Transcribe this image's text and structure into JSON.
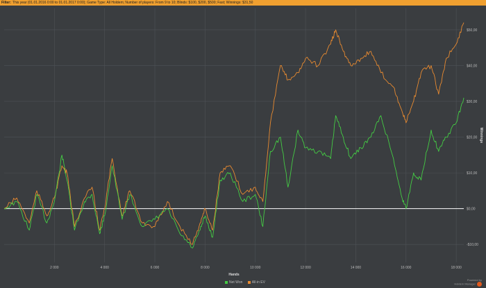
{
  "filter": {
    "label": "Filter:",
    "text": "This year (01.01.2016 0:00 to 01.01.2017 0:00); Game Type: All Holdem; Number of players: From 9 to 10; Blinds: $100, $200, $500; Fast; Winnings: $31,50"
  },
  "colors": {
    "net_won": "#44cc44",
    "all_in_ev": "#e88a30",
    "background": "#3a3d40",
    "grid": "#4e5256",
    "zero_line": "#ffffff"
  },
  "branding": {
    "line1": "Powered by",
    "line2": "Holdem Manager"
  },
  "chart_data": {
    "type": "line",
    "xlabel": "Hands",
    "ylabel": "Winnings",
    "xlim": [
      0,
      18300
    ],
    "ylim": [
      -15,
      56
    ],
    "x_ticks": [
      2000,
      4000,
      6000,
      8000,
      10000,
      12000,
      14000,
      16000,
      18000
    ],
    "x_tick_labels": [
      "2 000",
      "4 000",
      "6 000",
      "8 000",
      "10 000",
      "12 000",
      "14 000",
      "16 000",
      "18 000"
    ],
    "y_ticks": [
      -10,
      0,
      10,
      20,
      30,
      40,
      50
    ],
    "y_tick_labels": [
      "-$10,00",
      "$0,00",
      "$10,00",
      "$20,00",
      "$30,00",
      "$40,00",
      "$50,00"
    ],
    "grid": true,
    "legend": "bottom-center",
    "x": [
      0,
      500,
      1000,
      1300,
      1700,
      2000,
      2300,
      2500,
      2800,
      3200,
      3500,
      3800,
      4000,
      4300,
      4700,
      5000,
      5500,
      6000,
      6500,
      7000,
      7500,
      7800,
      8000,
      8300,
      8600,
      9000,
      9500,
      10000,
      10300,
      10600,
      11000,
      11300,
      11700,
      12000,
      12500,
      13000,
      13200,
      13500,
      13800,
      14200,
      14600,
      15000,
      15500,
      15800,
      16000,
      16300,
      16600,
      17000,
      17300,
      17600,
      18000,
      18300
    ],
    "series": [
      {
        "name": "Net Won",
        "values": [
          0,
          2,
          -6,
          4,
          -4,
          2,
          15,
          8,
          -6,
          2,
          4,
          -7,
          -2,
          12,
          -3,
          4,
          -5,
          -3,
          0,
          -7,
          -11,
          -6,
          -2,
          -8,
          8,
          10,
          2,
          4,
          -5,
          16,
          20,
          6,
          22,
          17,
          16,
          14,
          26,
          20,
          14,
          17,
          20,
          26,
          14,
          4,
          0,
          10,
          8,
          22,
          16,
          20,
          24,
          31
        ]
      },
      {
        "name": "All-in EV",
        "values": [
          0,
          3,
          -4,
          5,
          -2,
          3,
          12,
          10,
          -5,
          3,
          6,
          -6,
          0,
          14,
          -2,
          5,
          -4,
          -5,
          2,
          -5,
          -10,
          -4,
          0,
          -6,
          10,
          12,
          4,
          6,
          2,
          24,
          40,
          36,
          38,
          42,
          40,
          46,
          50,
          44,
          40,
          42,
          44,
          38,
          34,
          28,
          24,
          30,
          38,
          40,
          32,
          42,
          46,
          52
        ]
      }
    ]
  }
}
